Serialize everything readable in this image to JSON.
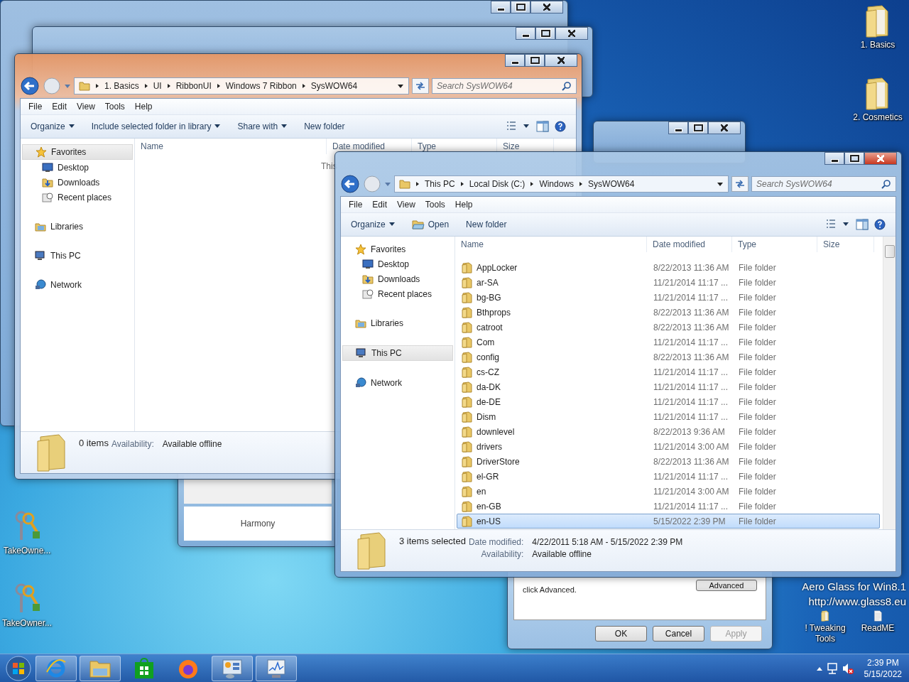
{
  "desktop_icons": [
    {
      "label": "1. Basics",
      "kind": "folder"
    },
    {
      "label": "2. Cosmetics",
      "kind": "folder"
    },
    {
      "label": "TakeOwne...",
      "kind": "keys"
    },
    {
      "label": "TakeOwner...",
      "kind": "keys"
    },
    {
      "label": "! Tweaking Tools",
      "kind": "folder"
    },
    {
      "label": "ReadME",
      "kind": "document"
    }
  ],
  "watermark_lines": [
    "Aero Glass for Win8.1",
    "http://www.glass8.eu"
  ],
  "harmony_window": {
    "text": "Harmony"
  },
  "properties_dialog": {
    "text": "click Advanced.",
    "advanced_button": "Advanced",
    "buttons": [
      {
        "label": "OK",
        "disabled": false
      },
      {
        "label": "Cancel",
        "disabled": false
      },
      {
        "label": "Apply",
        "disabled": true
      }
    ]
  },
  "back_explorer": {
    "breadcrumb": [
      "1. Basics",
      "UI",
      "RibbonUI",
      "Windows 7 Ribbon",
      "SysWOW64"
    ],
    "search": {
      "placeholder": "Search SysWOW64"
    },
    "menu": [
      "File",
      "Edit",
      "View",
      "Tools",
      "Help"
    ],
    "toolbar": [
      {
        "label": "Organize",
        "kind": "dropdown"
      },
      {
        "label": "Include selected folder in library",
        "kind": "dropdown"
      },
      {
        "label": "Share with",
        "kind": "dropdown"
      },
      {
        "label": "New folder",
        "kind": "plain"
      }
    ],
    "nav": [
      {
        "label": "Favorites",
        "kind": "star",
        "selected": true,
        "children": [
          {
            "label": "Desktop",
            "kind": "desktop",
            "selected": false
          },
          {
            "label": "Downloads",
            "kind": "downloads",
            "selected": false
          },
          {
            "label": "Recent places",
            "kind": "recent",
            "selected": false
          }
        ]
      },
      {
        "label": "Libraries",
        "kind": "libraries",
        "selected": false
      },
      {
        "label": "This PC",
        "kind": "pc",
        "selected": false
      },
      {
        "label": "Network",
        "kind": "network",
        "selected": false
      }
    ],
    "columns": [
      "Name",
      "Date modified",
      "Type",
      "Size"
    ],
    "empty_text": "This",
    "details": {
      "summary": "0 items",
      "fields": [
        {
          "label": "Availability:",
          "value": "Available offline"
        }
      ]
    }
  },
  "front_explorer": {
    "breadcrumb": [
      "This PC",
      "Local Disk (C:)",
      "Windows",
      "SysWOW64"
    ],
    "search": {
      "placeholder": "Search SysWOW64"
    },
    "menu": [
      "File",
      "Edit",
      "View",
      "Tools",
      "Help"
    ],
    "toolbar": [
      {
        "label": "Organize",
        "kind": "dropdown"
      },
      {
        "label": "Open",
        "kind": "open"
      },
      {
        "label": "New folder",
        "kind": "plain"
      }
    ],
    "nav": [
      {
        "label": "Favorites",
        "kind": "star",
        "selected": false,
        "children": [
          {
            "label": "Desktop",
            "kind": "desktop",
            "selected": false
          },
          {
            "label": "Downloads",
            "kind": "downloads",
            "selected": false
          },
          {
            "label": "Recent places",
            "kind": "recent",
            "selected": false
          }
        ]
      },
      {
        "label": "Libraries",
        "kind": "libraries",
        "selected": false
      },
      {
        "label": "This PC",
        "kind": "pc",
        "selected": true
      },
      {
        "label": "Network",
        "kind": "network",
        "selected": false
      }
    ],
    "columns": [
      "Name",
      "Date modified",
      "Type",
      "Size"
    ],
    "rows": [
      {
        "name": "AppLocker",
        "date": "8/22/2013 11:36 AM",
        "type": "File folder",
        "selected": false
      },
      {
        "name": "ar-SA",
        "date": "11/21/2014 11:17 ...",
        "type": "File folder",
        "selected": false
      },
      {
        "name": "bg-BG",
        "date": "11/21/2014 11:17 ...",
        "type": "File folder",
        "selected": false
      },
      {
        "name": "Bthprops",
        "date": "8/22/2013 11:36 AM",
        "type": "File folder",
        "selected": false
      },
      {
        "name": "catroot",
        "date": "8/22/2013 11:36 AM",
        "type": "File folder",
        "selected": false
      },
      {
        "name": "Com",
        "date": "11/21/2014 11:17 ...",
        "type": "File folder",
        "selected": false
      },
      {
        "name": "config",
        "date": "8/22/2013 11:36 AM",
        "type": "File folder",
        "selected": false
      },
      {
        "name": "cs-CZ",
        "date": "11/21/2014 11:17 ...",
        "type": "File folder",
        "selected": false
      },
      {
        "name": "da-DK",
        "date": "11/21/2014 11:17 ...",
        "type": "File folder",
        "selected": false
      },
      {
        "name": "de-DE",
        "date": "11/21/2014 11:17 ...",
        "type": "File folder",
        "selected": false
      },
      {
        "name": "Dism",
        "date": "11/21/2014 11:17 ...",
        "type": "File folder",
        "selected": false
      },
      {
        "name": "downlevel",
        "date": "8/22/2013 9:36 AM",
        "type": "File folder",
        "selected": false
      },
      {
        "name": "drivers",
        "date": "11/21/2014 3:00 AM",
        "type": "File folder",
        "selected": false
      },
      {
        "name": "DriverStore",
        "date": "8/22/2013 11:36 AM",
        "type": "File folder",
        "selected": false
      },
      {
        "name": "el-GR",
        "date": "11/21/2014 11:17 ...",
        "type": "File folder",
        "selected": false
      },
      {
        "name": "en",
        "date": "11/21/2014 3:00 AM",
        "type": "File folder",
        "selected": false
      },
      {
        "name": "en-GB",
        "date": "11/21/2014 11:17 ...",
        "type": "File folder",
        "selected": false
      },
      {
        "name": "en-US",
        "date": "5/15/2022 2:39 PM",
        "type": "File folder",
        "selected": true
      }
    ],
    "details": {
      "summary": "3 items selected",
      "fields": [
        {
          "label": "Date modified:",
          "value": "4/22/2011 5:18 AM - 5/15/2022 2:39 PM"
        },
        {
          "label": "Availability:",
          "value": "Available offline"
        }
      ]
    }
  },
  "taskbar": {
    "apps": [
      {
        "kind": "ie",
        "running": true
      },
      {
        "kind": "explorer",
        "running": true
      },
      {
        "kind": "store",
        "running": false
      },
      {
        "kind": "firefox",
        "running": false
      },
      {
        "kind": "control",
        "running": true
      },
      {
        "kind": "monitor",
        "running": true
      }
    ],
    "clock": {
      "time": "2:39 PM",
      "date": "5/15/2022"
    }
  }
}
